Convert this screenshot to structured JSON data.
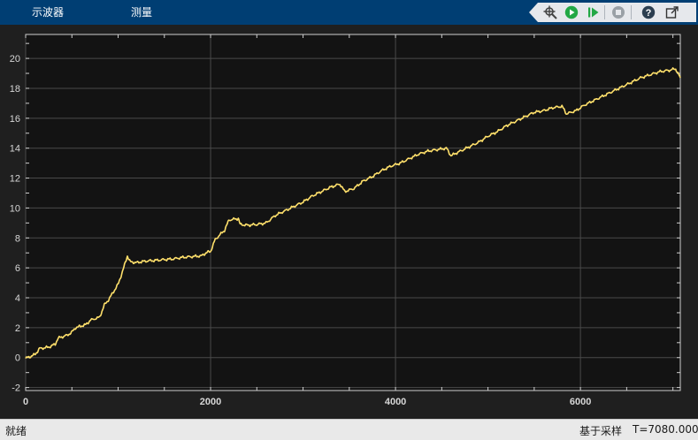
{
  "menu": {
    "tabs": [
      "示波器",
      "测量"
    ]
  },
  "toolbar": {
    "buttons": [
      "signal-select-icon",
      "run-icon",
      "step-forward-icon",
      "stop-icon",
      "help-icon",
      "undock-icon"
    ],
    "colors": {
      "run": "#22a845",
      "stop": "#9aa0a6"
    }
  },
  "status": {
    "left": "就绪",
    "mode": "基于采样",
    "time": "T=7080.0000"
  },
  "colors": {
    "trace": "#ffe06b",
    "axes_bg": "#131313",
    "grid": "#4a4a4a"
  },
  "chart_data": {
    "type": "line",
    "title": "",
    "xlabel": "",
    "ylabel": "",
    "xlim": [
      0,
      7080
    ],
    "ylim": [
      -2.2,
      21.6
    ],
    "xticks": [
      0,
      2000,
      4000,
      6000
    ],
    "yticks": [
      -2,
      0,
      2,
      4,
      6,
      8,
      10,
      12,
      14,
      16,
      18,
      20
    ],
    "grid": true,
    "series": [
      {
        "points": [
          [
            0,
            -0.05
          ],
          [
            60,
            0.1
          ],
          [
            100,
            0.2
          ],
          [
            150,
            0.6
          ],
          [
            250,
            0.7
          ],
          [
            320,
            0.9
          ],
          [
            350,
            1.3
          ],
          [
            450,
            1.5
          ],
          [
            500,
            1.7
          ],
          [
            540,
            2.0
          ],
          [
            650,
            2.2
          ],
          [
            700,
            2.5
          ],
          [
            800,
            2.7
          ],
          [
            850,
            3.5
          ],
          [
            900,
            3.9
          ],
          [
            950,
            4.4
          ],
          [
            1000,
            4.9
          ],
          [
            1050,
            5.8
          ],
          [
            1100,
            6.8
          ],
          [
            1130,
            6.4
          ],
          [
            1200,
            6.35
          ],
          [
            1300,
            6.45
          ],
          [
            1400,
            6.5
          ],
          [
            1500,
            6.55
          ],
          [
            1600,
            6.6
          ],
          [
            1700,
            6.7
          ],
          [
            1800,
            6.75
          ],
          [
            1900,
            6.8
          ],
          [
            1950,
            7.0
          ],
          [
            2000,
            7.1
          ],
          [
            2050,
            7.9
          ],
          [
            2150,
            8.5
          ],
          [
            2200,
            9.2
          ],
          [
            2300,
            9.3
          ],
          [
            2320,
            8.9
          ],
          [
            2400,
            8.85
          ],
          [
            2500,
            8.9
          ],
          [
            2600,
            9.0
          ],
          [
            2700,
            9.5
          ],
          [
            2800,
            9.8
          ],
          [
            2900,
            10.1
          ],
          [
            3000,
            10.4
          ],
          [
            3100,
            10.8
          ],
          [
            3200,
            11.1
          ],
          [
            3300,
            11.4
          ],
          [
            3400,
            11.6
          ],
          [
            3450,
            11.1
          ],
          [
            3550,
            11.3
          ],
          [
            3650,
            11.8
          ],
          [
            3750,
            12.1
          ],
          [
            3850,
            12.5
          ],
          [
            3950,
            12.8
          ],
          [
            4050,
            13.0
          ],
          [
            4150,
            13.3
          ],
          [
            4250,
            13.6
          ],
          [
            4350,
            13.8
          ],
          [
            4450,
            13.9
          ],
          [
            4550,
            14.0
          ],
          [
            4600,
            13.5
          ],
          [
            4700,
            13.8
          ],
          [
            4800,
            14.1
          ],
          [
            4900,
            14.4
          ],
          [
            5000,
            14.8
          ],
          [
            5100,
            15.1
          ],
          [
            5200,
            15.5
          ],
          [
            5300,
            15.8
          ],
          [
            5400,
            16.1
          ],
          [
            5500,
            16.4
          ],
          [
            5600,
            16.5
          ],
          [
            5700,
            16.7
          ],
          [
            5800,
            16.8
          ],
          [
            5850,
            16.3
          ],
          [
            5950,
            16.5
          ],
          [
            6050,
            16.9
          ],
          [
            6150,
            17.2
          ],
          [
            6250,
            17.5
          ],
          [
            6350,
            17.8
          ],
          [
            6450,
            18.1
          ],
          [
            6550,
            18.4
          ],
          [
            6650,
            18.7
          ],
          [
            6750,
            18.9
          ],
          [
            6850,
            19.1
          ],
          [
            6950,
            19.2
          ],
          [
            7030,
            19.3
          ],
          [
            7080,
            18.7
          ]
        ]
      }
    ]
  }
}
